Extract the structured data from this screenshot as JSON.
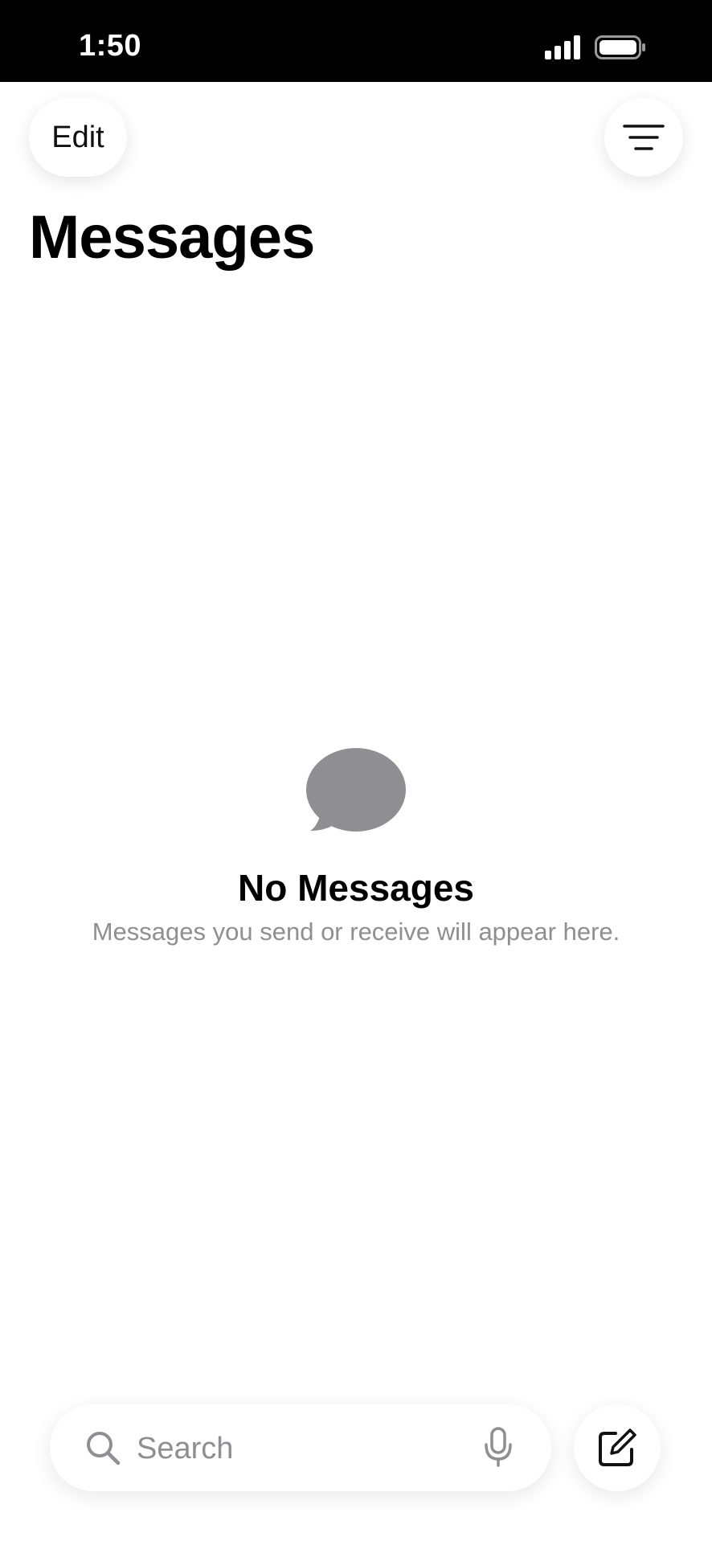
{
  "status_bar": {
    "time": "1:50",
    "signal_icon": "cellular-signal-icon",
    "battery_icon": "battery-full-icon"
  },
  "header": {
    "edit_label": "Edit",
    "filter_icon": "filter-lines-icon",
    "title": "Messages"
  },
  "empty_state": {
    "icon": "chat-bubble-icon",
    "title": "No Messages",
    "subtitle": "Messages you send or receive will appear here."
  },
  "search": {
    "placeholder": "Search",
    "value": "",
    "search_icon": "magnifying-glass-icon",
    "mic_icon": "microphone-icon"
  },
  "compose": {
    "icon": "compose-icon"
  },
  "colors": {
    "status_bar_bg": "#000000",
    "secondary_text": "#8e8e93",
    "icon_gray": "#8e8e93",
    "background": "#ffffff"
  }
}
